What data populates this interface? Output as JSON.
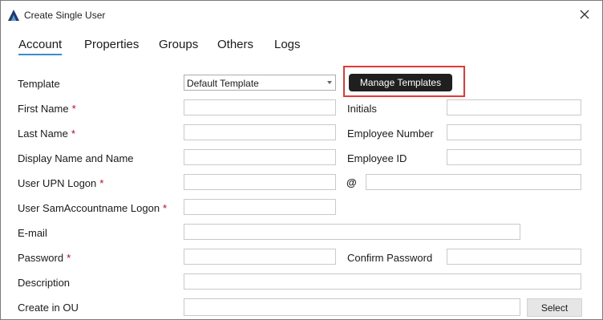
{
  "window": {
    "title": "Create Single User",
    "close_glyph": "✕"
  },
  "tabs": [
    {
      "label": "Account",
      "active": true
    },
    {
      "label": "Properties",
      "active": false
    },
    {
      "label": "Groups",
      "active": false
    },
    {
      "label": "Others",
      "active": false
    },
    {
      "label": "Logs",
      "active": false
    }
  ],
  "form": {
    "required_marker": "*",
    "template": {
      "label": "Template",
      "selected": "Default Template"
    },
    "manage_templates_label": "Manage Templates",
    "first_name": {
      "label": "First Name",
      "value": ""
    },
    "initials": {
      "label": "Initials",
      "value": ""
    },
    "last_name": {
      "label": "Last Name",
      "value": ""
    },
    "employee_number": {
      "label": "Employee Number",
      "value": ""
    },
    "display_name": {
      "label": "Display Name and Name",
      "value": ""
    },
    "employee_id": {
      "label": "Employee ID",
      "value": ""
    },
    "upn_logon": {
      "label": "User UPN Logon",
      "value": "",
      "at_symbol": "@",
      "domain_value": ""
    },
    "sam_logon": {
      "label": "User SamAccountname Logon",
      "value": ""
    },
    "email": {
      "label": "E-mail",
      "value": ""
    },
    "password": {
      "label": "Password",
      "value": ""
    },
    "confirm_password": {
      "label": "Confirm Password",
      "value": ""
    },
    "description": {
      "label": "Description",
      "value": ""
    },
    "create_in_ou": {
      "label": "Create in OU",
      "value": ""
    },
    "select_label": "Select"
  },
  "colors": {
    "tab_underline": "#3a8ccc",
    "required": "#d0021b",
    "highlight": "#e53935",
    "dark_button": "#1f1f1f"
  },
  "icons": {
    "app": "app-logo-icon",
    "close": "close-icon",
    "dropdown": "chevron-down-icon"
  }
}
